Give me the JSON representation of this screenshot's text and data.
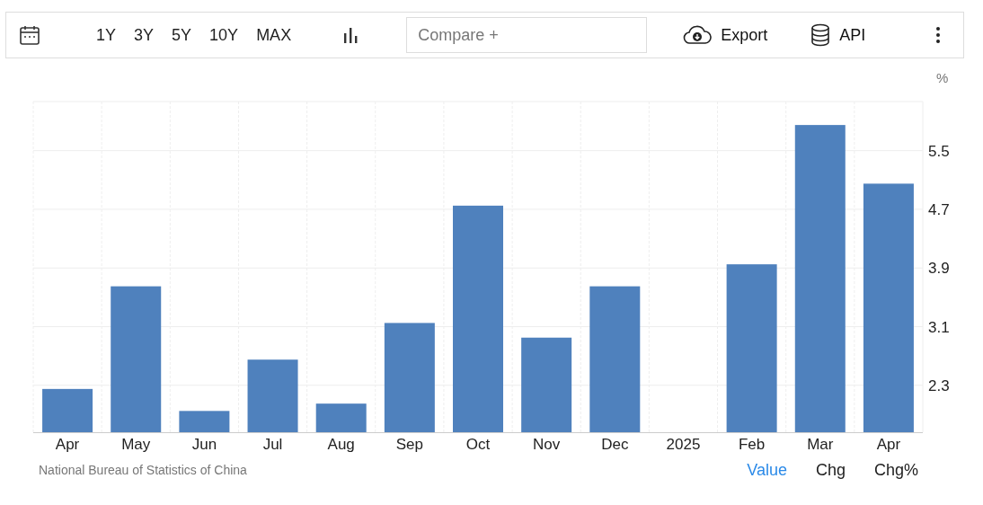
{
  "toolbar": {
    "ranges": [
      {
        "label": "1Y",
        "selected": false
      },
      {
        "label": "3Y",
        "selected": false
      },
      {
        "label": "5Y",
        "selected": false
      },
      {
        "label": "10Y",
        "selected": false
      },
      {
        "label": "MAX",
        "selected": false
      }
    ],
    "compare": {
      "placeholder": "Compare +"
    },
    "export": "Export",
    "api": "API"
  },
  "chart": {
    "unit": "%",
    "chart_data": {
      "type": "bar",
      "categories": [
        "Apr",
        "May",
        "Jun",
        "Jul",
        "Aug",
        "Sep",
        "Oct",
        "Nov",
        "Dec",
        "2025",
        "Feb",
        "Mar",
        "Apr"
      ],
      "grid": true,
      "series": [
        {
          "color": "#4f81bd",
          "values": [
            2.25,
            3.65,
            1.95,
            2.65,
            2.05,
            3.15,
            4.75,
            2.95,
            3.65,
            null,
            3.95,
            5.85,
            5.05
          ]
        }
      ],
      "ylim": [
        1.66,
        6.17
      ],
      "yticks": [
        2.3,
        3.1,
        3.9,
        4.7,
        5.5
      ]
    }
  },
  "footer": {
    "source": "National Bureau of Statistics of China",
    "views": [
      {
        "label": "Value",
        "selected": true
      },
      {
        "label": "Chg",
        "selected": false
      },
      {
        "label": "Chg%",
        "selected": false
      }
    ]
  }
}
